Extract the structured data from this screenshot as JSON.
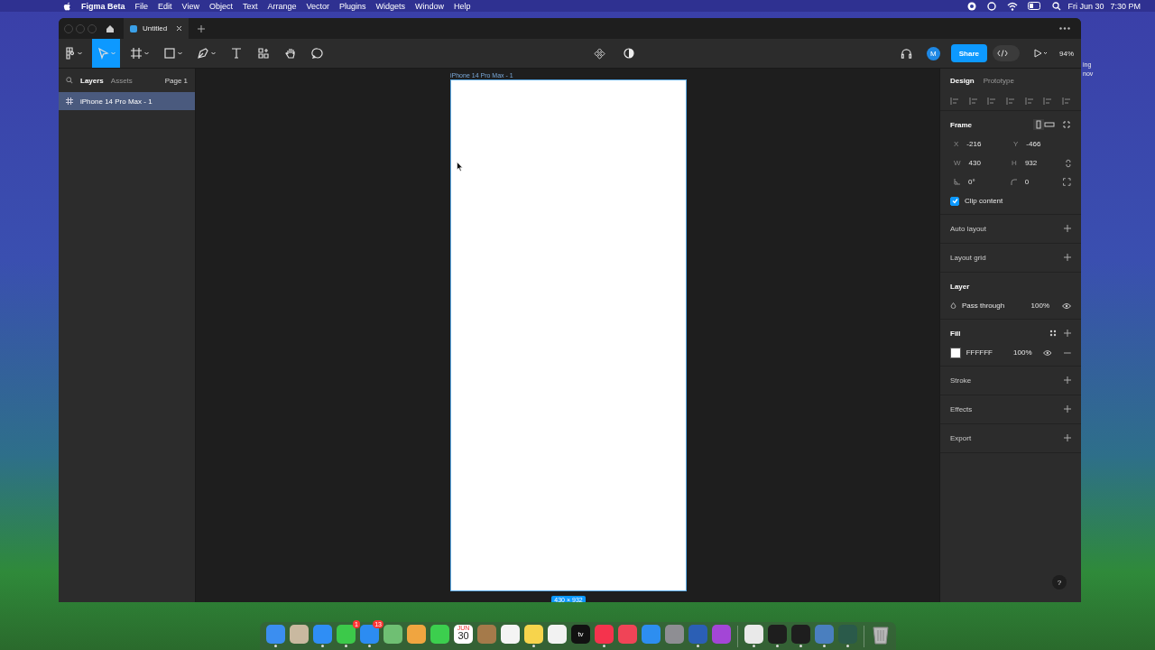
{
  "menubar": {
    "app": "Figma Beta",
    "menus": [
      "File",
      "Edit",
      "View",
      "Object",
      "Text",
      "Arrange",
      "Vector",
      "Plugins",
      "Widgets",
      "Window",
      "Help"
    ],
    "date": "Fri Jun 30",
    "time": "7:30 PM"
  },
  "desktop_fragments": [
    "ing",
    "nov"
  ],
  "tabs": [
    {
      "label": "Untitled",
      "selected": true
    }
  ],
  "toolbar": {
    "tools": [
      {
        "kind": "menu",
        "selected": false
      },
      {
        "kind": "move",
        "selected": true
      },
      {
        "kind": "frame",
        "selected": false
      },
      {
        "kind": "shape",
        "selected": false
      },
      {
        "kind": "pen",
        "selected": false
      },
      {
        "kind": "text",
        "selected": false
      },
      {
        "kind": "resources",
        "selected": false
      },
      {
        "kind": "hand",
        "selected": false
      },
      {
        "kind": "comment",
        "selected": false
      }
    ],
    "avatar": "M",
    "share": "Share",
    "dev_mode": {
      "on": false
    },
    "zoom": "94%"
  },
  "left_panel": {
    "tabs": [
      {
        "label": "Layers",
        "selected": true
      },
      {
        "label": "Assets",
        "selected": false
      }
    ],
    "page": "Page 1",
    "layers": [
      {
        "name": "iPhone 14 Pro Max - 1",
        "selected": true
      }
    ]
  },
  "canvas": {
    "frame_label": "iPhone 14 Pro Max - 1",
    "size": "430 × 932"
  },
  "right_panel": {
    "tabs": [
      {
        "label": "Design",
        "selected": true
      },
      {
        "label": "Prototype",
        "selected": false
      }
    ],
    "frame": {
      "title": "Frame",
      "rows": [
        [
          {
            "kind": "label",
            "label": "X",
            "value": "-216"
          },
          {
            "kind": "label",
            "label": "Y",
            "value": "-466"
          }
        ],
        [
          {
            "kind": "label",
            "label": "W",
            "value": "430"
          },
          {
            "kind": "label",
            "label": "H",
            "value": "932"
          }
        ],
        [
          {
            "kind": "rotation",
            "value": "0°"
          },
          {
            "kind": "radius",
            "value": "0"
          }
        ]
      ],
      "clip": {
        "label": "Clip content",
        "checked": true
      }
    },
    "sections_top": [
      "Auto layout",
      "Layout grid"
    ],
    "layer": {
      "title": "Layer",
      "blend": "Pass through",
      "opacity": "100%"
    },
    "fill": {
      "title": "Fill",
      "hex": "FFFFFF",
      "opacity": "100%",
      "color": "#ffffff"
    },
    "sections_bottom": [
      "Stroke",
      "Effects",
      "Export"
    ],
    "help": "?"
  },
  "dock": [
    {
      "kind": "app",
      "color": "#3b8ef0",
      "running": true
    },
    {
      "kind": "app",
      "color": "#c9b9a0",
      "running": false
    },
    {
      "kind": "app",
      "color": "#2f8ef5",
      "running": true
    },
    {
      "kind": "app",
      "color": "#3cc94a",
      "running": true,
      "badge": "1"
    },
    {
      "kind": "app",
      "color": "#2c8cf2",
      "running": true,
      "badge": "13"
    },
    {
      "kind": "app",
      "color": "#6fbf73",
      "running": false
    },
    {
      "kind": "app",
      "color": "#f0a540",
      "running": false
    },
    {
      "kind": "app",
      "color": "#3ccf4e",
      "running": false
    },
    {
      "kind": "calendar",
      "month": "JUN",
      "day": "30",
      "running": false
    },
    {
      "kind": "app",
      "color": "#a57a4a",
      "running": false
    },
    {
      "kind": "app",
      "color": "#f4f4f4",
      "running": false
    },
    {
      "kind": "app",
      "color": "#f7d44c",
      "running": true
    },
    {
      "kind": "app",
      "color": "#f2f2f2",
      "running": false
    },
    {
      "kind": "tv",
      "label": "tv",
      "running": false
    },
    {
      "kind": "app",
      "color": "#f5334d",
      "running": true
    },
    {
      "kind": "app",
      "color": "#f04457",
      "running": false
    },
    {
      "kind": "app",
      "color": "#2d8ef0",
      "running": false
    },
    {
      "kind": "app",
      "color": "#8e8e93",
      "running": false
    },
    {
      "kind": "app",
      "color": "#2b5fb5",
      "running": true
    },
    {
      "kind": "app",
      "color": "#a346d6",
      "running": false
    },
    {
      "kind": "separator"
    },
    {
      "kind": "app",
      "color": "#e9e9e9",
      "running": true
    },
    {
      "kind": "app",
      "color": "#1e1e1e",
      "running": true
    },
    {
      "kind": "app",
      "color": "#1e1e1e",
      "running": true
    },
    {
      "kind": "app",
      "color": "#4a7fbf",
      "running": true
    },
    {
      "kind": "app",
      "color": "#2a5a4a",
      "running": true
    },
    {
      "kind": "separator"
    },
    {
      "kind": "trash",
      "running": false
    }
  ]
}
